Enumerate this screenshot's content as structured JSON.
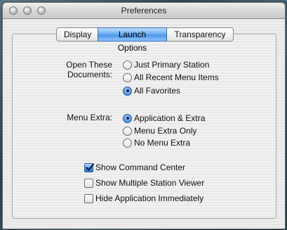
{
  "window": {
    "title": "Preferences"
  },
  "tabs": [
    {
      "label": "Display",
      "selected": false
    },
    {
      "label": "Launch Options",
      "selected": true
    },
    {
      "label": "Transparency",
      "selected": false
    }
  ],
  "open_documents": {
    "label_line1": "Open These",
    "label_line2": "Documents:",
    "options": [
      {
        "label": "Just Primary Station",
        "selected": false
      },
      {
        "label": "All Recent Menu Items",
        "selected": false
      },
      {
        "label": "All Favorites",
        "selected": true
      }
    ]
  },
  "menu_extra": {
    "label": "Menu Extra:",
    "options": [
      {
        "label": "Application & Extra",
        "selected": true
      },
      {
        "label": "Menu Extra Only",
        "selected": false
      },
      {
        "label": "No Menu Extra",
        "selected": false
      }
    ]
  },
  "checkboxes": [
    {
      "label": "Show Command Center",
      "checked": true
    },
    {
      "label": "Show Multiple Station Viewer",
      "checked": false
    },
    {
      "label": "Hide Application Immediately",
      "checked": false
    }
  ],
  "colors": {
    "accent": "#4f95e6",
    "window_bg": "#eeeeee"
  }
}
